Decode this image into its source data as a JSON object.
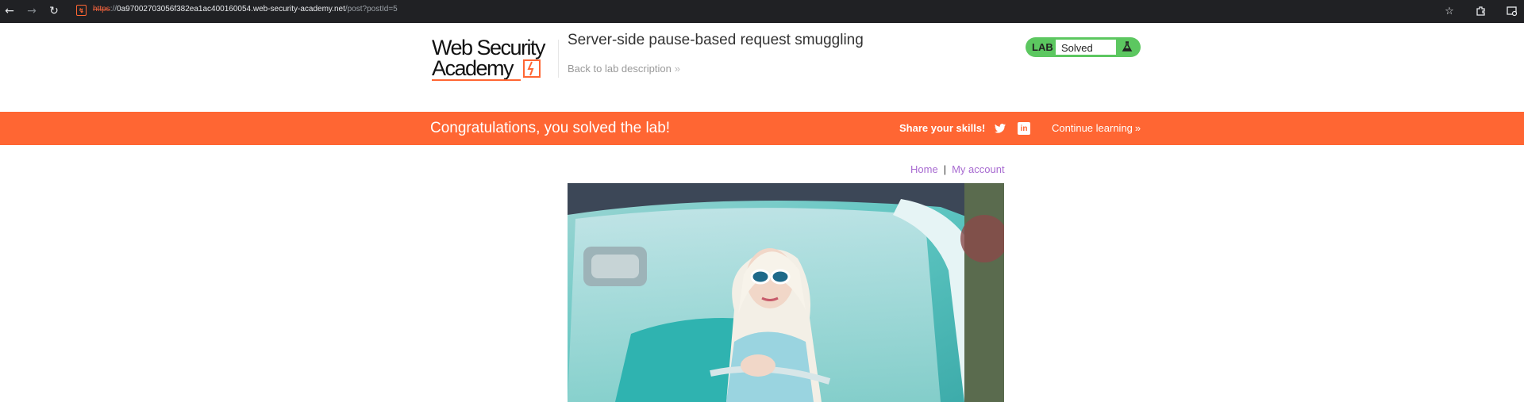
{
  "browser": {
    "url_scheme": "https",
    "url_separator": "://",
    "url_host": "0a97002703056f382ea1ac400160054.web-security-academy.net",
    "url_path": "/post?postId=5",
    "back_icon": "arrow-left-icon",
    "forward_icon": "arrow-right-icon",
    "reload_icon": "reload-icon"
  },
  "header": {
    "logo_line1": "Web Security",
    "logo_line2": "Academy",
    "lab_title": "Server-side pause-based request smuggling",
    "back_link": "Back to lab description",
    "status_label": "LAB",
    "status_value": "Solved"
  },
  "banner": {
    "message": "Congratulations, you solved the lab!",
    "share_label": "Share your skills!",
    "continue_label": "Continue learning"
  },
  "nav": {
    "home": "Home",
    "separator": "|",
    "account": "My account"
  },
  "colors": {
    "brand_orange": "#ff6633",
    "status_green": "#5cc760",
    "link_purple": "#a86bd1",
    "chrome_dark": "#202124"
  }
}
